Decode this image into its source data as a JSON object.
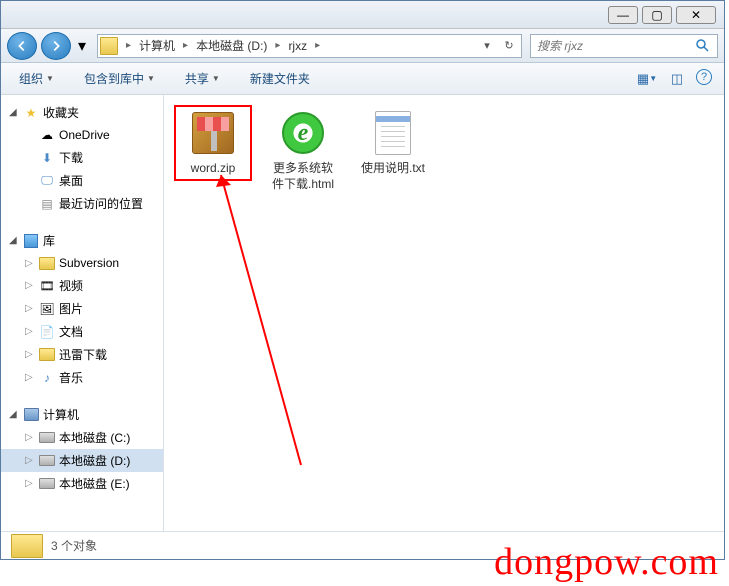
{
  "window_controls": {
    "min": "—",
    "max": "▢",
    "close": "✕"
  },
  "breadcrumb": [
    "计算机",
    "本地磁盘 (D:)",
    "rjxz"
  ],
  "search": {
    "placeholder": "搜索 rjxz"
  },
  "toolbar": {
    "organize": "组织",
    "include": "包含到库中",
    "share": "共享",
    "newfolder": "新建文件夹"
  },
  "sidebar": {
    "favorites": {
      "label": "收藏夹",
      "items": [
        "OneDrive",
        "下载",
        "桌面",
        "最近访问的位置"
      ]
    },
    "libraries": {
      "label": "库",
      "items": [
        "Subversion",
        "视频",
        "图片",
        "文档",
        "迅雷下载",
        "音乐"
      ]
    },
    "computer": {
      "label": "计算机",
      "items": [
        "本地磁盘 (C:)",
        "本地磁盘 (D:)",
        "本地磁盘 (E:)"
      ]
    }
  },
  "files": [
    {
      "name": "word.zip",
      "type": "zip"
    },
    {
      "name": "更多系统软件下载.html",
      "type": "html"
    },
    {
      "name": "使用说明.txt",
      "type": "txt"
    }
  ],
  "statusbar": {
    "count": "3 个对象"
  },
  "watermark": "dongpow.com"
}
